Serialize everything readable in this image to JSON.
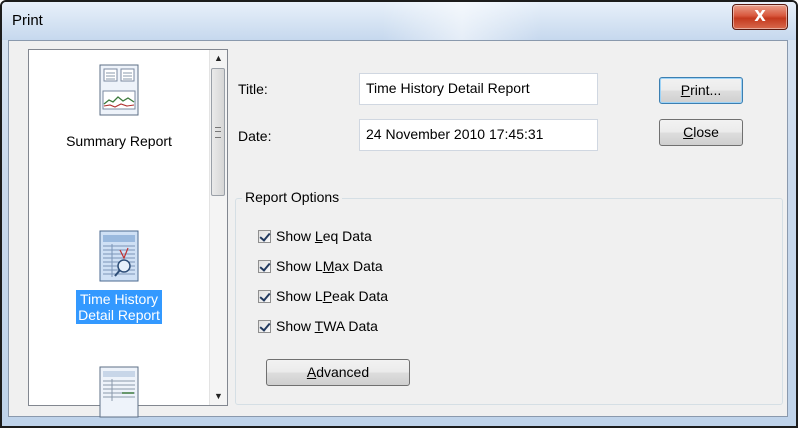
{
  "window": {
    "title": "Print",
    "close_glyph": "X"
  },
  "reports": [
    {
      "label": "Summary Report",
      "selected": false
    },
    {
      "label_line1": "Time History",
      "label_line2": "Detail Report",
      "selected": true
    },
    {
      "label": "",
      "selected": false
    }
  ],
  "form": {
    "title_label": "Title:",
    "title_value": "Time History Detail Report",
    "date_label": "Date:",
    "date_value": "24 November 2010 17:45:31"
  },
  "buttons": {
    "print_mnemonic": "P",
    "print_rest": "rint...",
    "close_mnemonic": "C",
    "close_rest": "lose",
    "advanced_mnemonic": "A",
    "advanced_rest": "dvanced"
  },
  "options": {
    "group_title": "Report Options",
    "items": [
      {
        "pre": "Show ",
        "mnemonic": "L",
        "post": "eq Data",
        "checked": true
      },
      {
        "pre": "Show L",
        "mnemonic": "M",
        "post": "ax Data",
        "checked": true
      },
      {
        "pre": "Show L",
        "mnemonic": "P",
        "post": "eak Data",
        "checked": true
      },
      {
        "pre": "Show ",
        "mnemonic": "T",
        "post": "WA Data",
        "checked": true
      }
    ]
  },
  "icons": {
    "scroll_up": "▲",
    "scroll_down": "▼"
  },
  "colors": {
    "selection": "#3399ff",
    "close_button": "#c4391e"
  }
}
